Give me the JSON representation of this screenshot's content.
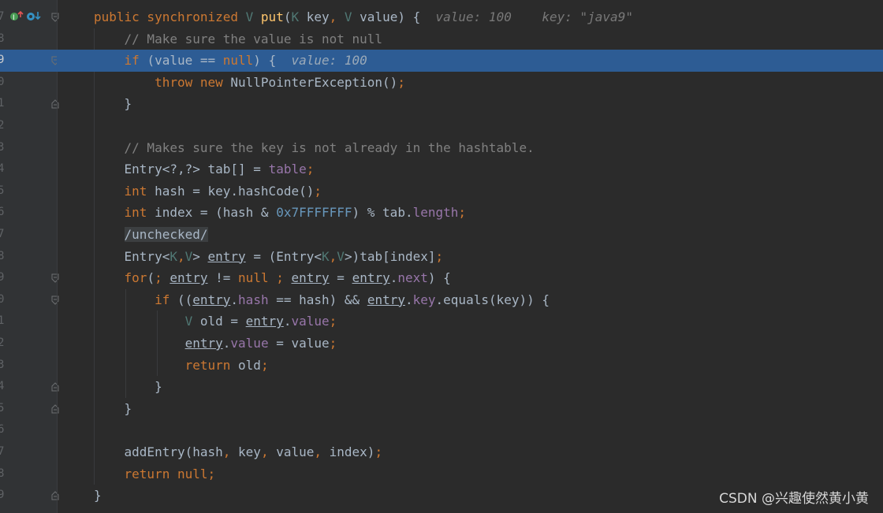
{
  "editor": {
    "lines": [
      {
        "num": "7",
        "code": [
          [
            "kw",
            "public synchronized "
          ],
          [
            "tp",
            "V "
          ],
          [
            "fn",
            "put"
          ],
          [
            "",
            "("
          ],
          [
            "tp",
            "K "
          ],
          [
            "",
            "key"
          ],
          [
            "kw",
            ", "
          ],
          [
            "tp",
            "V "
          ],
          [
            "",
            "value) {  "
          ],
          [
            "hint",
            "value: 100    key: \"java9\""
          ]
        ]
      },
      {
        "num": "8",
        "code": [
          [
            "",
            "    "
          ],
          [
            "cm",
            "// Make sure the value is not null"
          ]
        ]
      },
      {
        "num": "9",
        "highlight": true,
        "code": [
          [
            "",
            "    "
          ],
          [
            "kw",
            "if "
          ],
          [
            "",
            "(value == "
          ],
          [
            "kw",
            "null"
          ],
          [
            "",
            ") {  "
          ],
          [
            "hint-hl",
            "value: 100"
          ]
        ]
      },
      {
        "num": "0",
        "code": [
          [
            "",
            "        "
          ],
          [
            "kw",
            "throw new "
          ],
          [
            "",
            "NullPointerException()"
          ],
          [
            "kw",
            ";"
          ]
        ]
      },
      {
        "num": "1",
        "code": [
          [
            "",
            "    }"
          ]
        ]
      },
      {
        "num": "2",
        "code": []
      },
      {
        "num": "3",
        "code": [
          [
            "",
            "    "
          ],
          [
            "cm",
            "// Makes sure the key is not already in the hashtable."
          ]
        ]
      },
      {
        "num": "4",
        "code": [
          [
            "",
            "    Entry<?,?> tab[] = "
          ],
          [
            "fld",
            "table"
          ],
          [
            "kw",
            ";"
          ]
        ]
      },
      {
        "num": "5",
        "code": [
          [
            "",
            "    "
          ],
          [
            "kw",
            "int "
          ],
          [
            "",
            "hash = key.hashCode()"
          ],
          [
            "kw",
            ";"
          ]
        ]
      },
      {
        "num": "6",
        "code": [
          [
            "",
            "    "
          ],
          [
            "kw",
            "int "
          ],
          [
            "",
            "index = (hash & "
          ],
          [
            "num",
            "0x7FFFFFFF"
          ],
          [
            "",
            ") % tab."
          ],
          [
            "fld",
            "length"
          ],
          [
            "kw",
            ";"
          ]
        ]
      },
      {
        "num": "7",
        "code": [
          [
            "",
            "    "
          ],
          [
            "ph",
            "/unchecked/"
          ]
        ]
      },
      {
        "num": "8",
        "code": [
          [
            "",
            "    Entry<"
          ],
          [
            "tp",
            "K"
          ],
          [
            "kw",
            ","
          ],
          [
            "tp",
            "V"
          ],
          [
            "",
            "> "
          ],
          [
            "ul",
            "entry"
          ],
          [
            "",
            " = (Entry<"
          ],
          [
            "tp",
            "K"
          ],
          [
            "kw",
            ","
          ],
          [
            "tp",
            "V"
          ],
          [
            "",
            ">)tab[index]"
          ],
          [
            "kw",
            ";"
          ]
        ]
      },
      {
        "num": "9",
        "code": [
          [
            "",
            "    "
          ],
          [
            "kw",
            "for"
          ],
          [
            "",
            "("
          ],
          [
            "kw",
            "; "
          ],
          [
            "ul",
            "entry"
          ],
          [
            "",
            " != "
          ],
          [
            "kw",
            "null ; "
          ],
          [
            "ul",
            "entry"
          ],
          [
            "",
            " = "
          ],
          [
            "ul",
            "entry"
          ],
          [
            "",
            "."
          ],
          [
            "fld",
            "next"
          ],
          [
            "",
            ") {"
          ]
        ]
      },
      {
        "num": "0",
        "code": [
          [
            "",
            "        "
          ],
          [
            "kw",
            "if "
          ],
          [
            "",
            "(("
          ],
          [
            "ul",
            "entry"
          ],
          [
            "",
            "."
          ],
          [
            "fld",
            "hash"
          ],
          [
            "",
            " == hash) && "
          ],
          [
            "ul",
            "entry"
          ],
          [
            "",
            "."
          ],
          [
            "fld",
            "key"
          ],
          [
            "",
            ".equals(key)) {"
          ]
        ]
      },
      {
        "num": "1",
        "code": [
          [
            "",
            "            "
          ],
          [
            "tp",
            "V "
          ],
          [
            "",
            "old = "
          ],
          [
            "ul",
            "entry"
          ],
          [
            "",
            "."
          ],
          [
            "fld",
            "value"
          ],
          [
            "kw",
            ";"
          ]
        ]
      },
      {
        "num": "2",
        "code": [
          [
            "",
            "            "
          ],
          [
            "ul",
            "entry"
          ],
          [
            "",
            "."
          ],
          [
            "fld",
            "value"
          ],
          [
            "",
            " = value"
          ],
          [
            "kw",
            ";"
          ]
        ]
      },
      {
        "num": "3",
        "code": [
          [
            "",
            "            "
          ],
          [
            "kw",
            "return "
          ],
          [
            "",
            "old"
          ],
          [
            "kw",
            ";"
          ]
        ]
      },
      {
        "num": "4",
        "code": [
          [
            "",
            "        }"
          ]
        ]
      },
      {
        "num": "5",
        "code": [
          [
            "",
            "    }"
          ]
        ]
      },
      {
        "num": "6",
        "code": []
      },
      {
        "num": "7",
        "code": [
          [
            "",
            "    addEntry(hash"
          ],
          [
            "kw",
            ", "
          ],
          [
            "",
            "key"
          ],
          [
            "kw",
            ", "
          ],
          [
            "",
            "value"
          ],
          [
            "kw",
            ", "
          ],
          [
            "",
            "index)"
          ],
          [
            "kw",
            ";"
          ]
        ]
      },
      {
        "num": "8",
        "code": [
          [
            "",
            "    "
          ],
          [
            "kw",
            "return null;"
          ]
        ]
      },
      {
        "num": "9",
        "code": [
          [
            "",
            "}"
          ]
        ]
      }
    ]
  },
  "watermark": "CSDN @兴趣使然黄小黄",
  "colors": {
    "background": "#2b2b2b",
    "gutter": "#313335",
    "highlight": "#2d5c94",
    "keyword": "#cc7832",
    "comment": "#808080"
  }
}
